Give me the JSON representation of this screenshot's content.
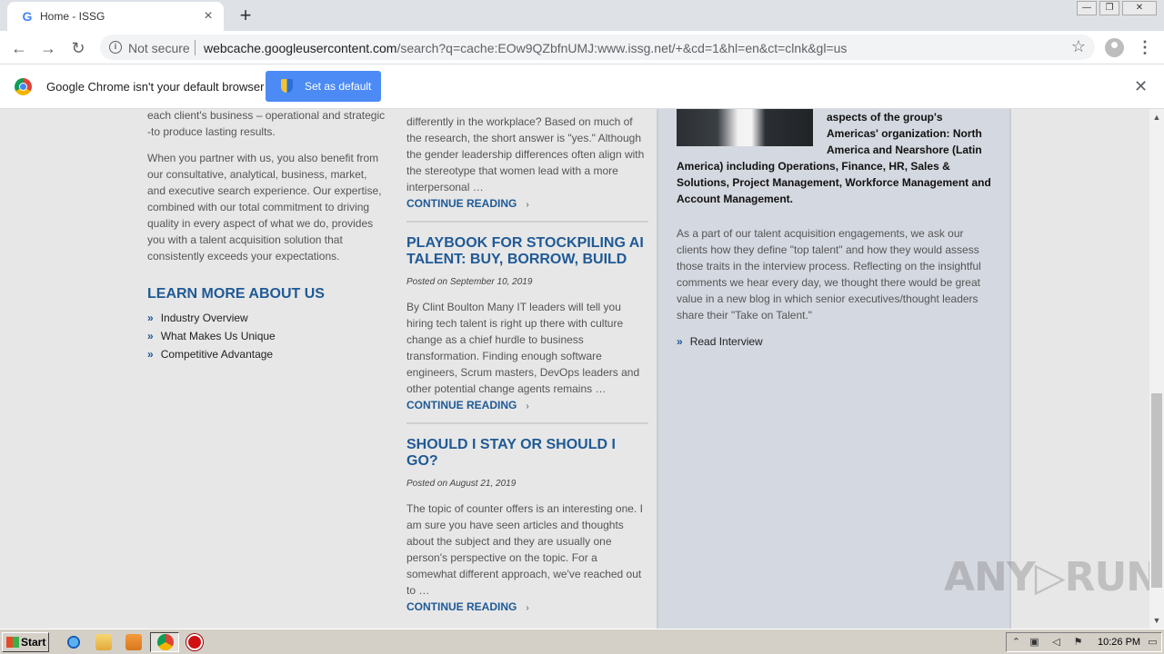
{
  "browser": {
    "tab_title": "Home - ISSG",
    "tab_favicon": "G",
    "tab_close": "×",
    "new_tab": "+",
    "security_label": "Not secure",
    "url_host": "webcache.googleusercontent.com",
    "url_rest": "/search?q=cache:EOw9QZbfnUMJ:www.issg.net/+&cd=1&hl=en&ct=clnk&gl=us",
    "back_icon": "←",
    "forward_icon": "→",
    "reload_icon": "↻",
    "star_icon": "☆",
    "menu_icon": "⋮",
    "window_controls": {
      "minimize": "—",
      "restore": "❐",
      "close": "✕"
    }
  },
  "infobar": {
    "message": "Google Chrome isn't your default browser",
    "button_label": "Set as default",
    "close": "✕"
  },
  "left_column": {
    "p1": "each client's business – operational and strategic -to produce lasting results.",
    "p2": "When you partner with us, you also benefit from our consultative, analytical, business, market, and executive search experience. Our expertise, combined with our total commitment to driving quality in every aspect of what we do, provides you with a talent acquisition solution that consistently exceeds your expectations.",
    "learn_title": "LEARN MORE ABOUT US",
    "links": [
      "Industry Overview",
      "What Makes Us Unique",
      "Competitive Advantage"
    ],
    "link_chevron": "»"
  },
  "posts": {
    "first_snippet": "differently in the workplace? Based on much of the research, the short answer is \"yes.\" Although the gender leadership differences often align with the stereotype that women lead with a more interpersonal …",
    "continue_label": "CONTINUE READING",
    "continue_arrow": "›",
    "post2": {
      "title": "PLAYBOOK FOR STOCKPILING AI TALENT: BUY, BORROW, BUILD",
      "date": "Posted on September 10, 2019",
      "snippet": "By Clint Boulton Many IT leaders will tell you hiring tech talent is right up there with culture change as a chief hurdle to business transformation. Finding enough software engineers, Scrum masters, DevOps leaders and other potential change agents remains …"
    },
    "post3": {
      "title": "SHOULD I STAY OR SHOULD I GO?",
      "date": "Posted on August 21, 2019",
      "snippet": "The topic of counter offers is an interesting one. I am sure you have seen articles and thoughts about the subject and they are usually one person's perspective on the topic. For a somewhat different approach, we've reached out to …"
    }
  },
  "right_panel": {
    "bio_lines": [
      "aspects of the group's",
      "Americas' organization: North",
      "America and Nearshore (Latin"
    ],
    "bio_rest": "America) including Operations, Finance, HR, Sales & Solutions, Project Management, Workforce Management and Account Management.",
    "talent_text": "As a part of our talent acquisition engagements, we ask our clients how they define \"top talent\" and how they would assess those traits in the interview process. Reflecting on the insightful comments we hear every day, we thought there would be great value in a new blog in which senior executives/thought leaders share their \"Take on Talent.\"",
    "read_interview": "Read Interview",
    "chevron": "»"
  },
  "watermark": "ANY▷RUN",
  "taskbar": {
    "start_label": "Start",
    "clock": "10:26 PM"
  }
}
